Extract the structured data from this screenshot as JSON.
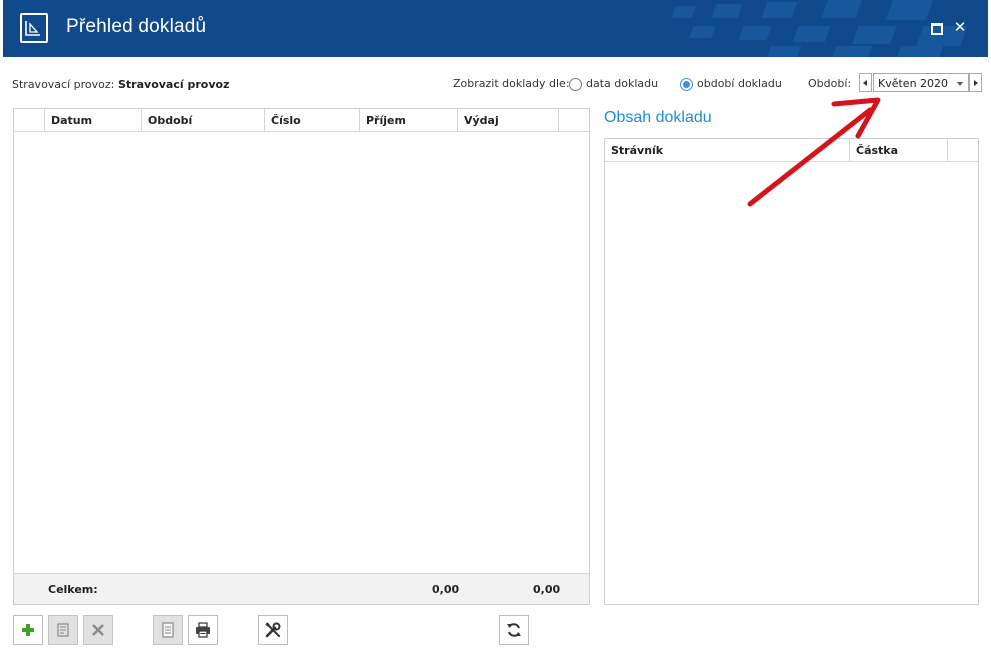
{
  "window": {
    "title": "Přehled dokladů",
    "close_glyph": "✕",
    "accent_color": "#114a8c"
  },
  "filters": {
    "provoz_label": "Stravovací provoz:",
    "provoz_value": "Stravovací provoz",
    "show_by_label": "Zobrazit doklady dle:",
    "radio_date_label": "data dokladu",
    "radio_period_label": "období dokladu",
    "selected_radio": "období dokladu",
    "period_label": "Období:",
    "period_value": "Květen 2020"
  },
  "documents_grid": {
    "columns": [
      "Datum",
      "Období",
      "Číslo",
      "Příjem",
      "Výdaj"
    ],
    "rows": [],
    "footer": {
      "total_label": "Celkem:",
      "income_total": "0,00",
      "expense_total": "0,00"
    }
  },
  "content_section": {
    "title": "Obsah dokladu",
    "columns": [
      "Strávník",
      "Částka"
    ],
    "rows": []
  },
  "toolbar": {
    "buttons": [
      {
        "icon": "plus-icon",
        "enabled": true
      },
      {
        "icon": "edit-document-icon",
        "enabled": false
      },
      {
        "icon": "delete-x-icon",
        "enabled": false
      },
      {
        "icon": "document-icon",
        "enabled": false
      },
      {
        "icon": "printer-icon",
        "enabled": true
      },
      {
        "icon": "tools-icon",
        "enabled": true
      },
      {
        "icon": "refresh-icon",
        "enabled": true
      }
    ]
  },
  "annotation": {
    "arrow_color": "#d4141c"
  }
}
